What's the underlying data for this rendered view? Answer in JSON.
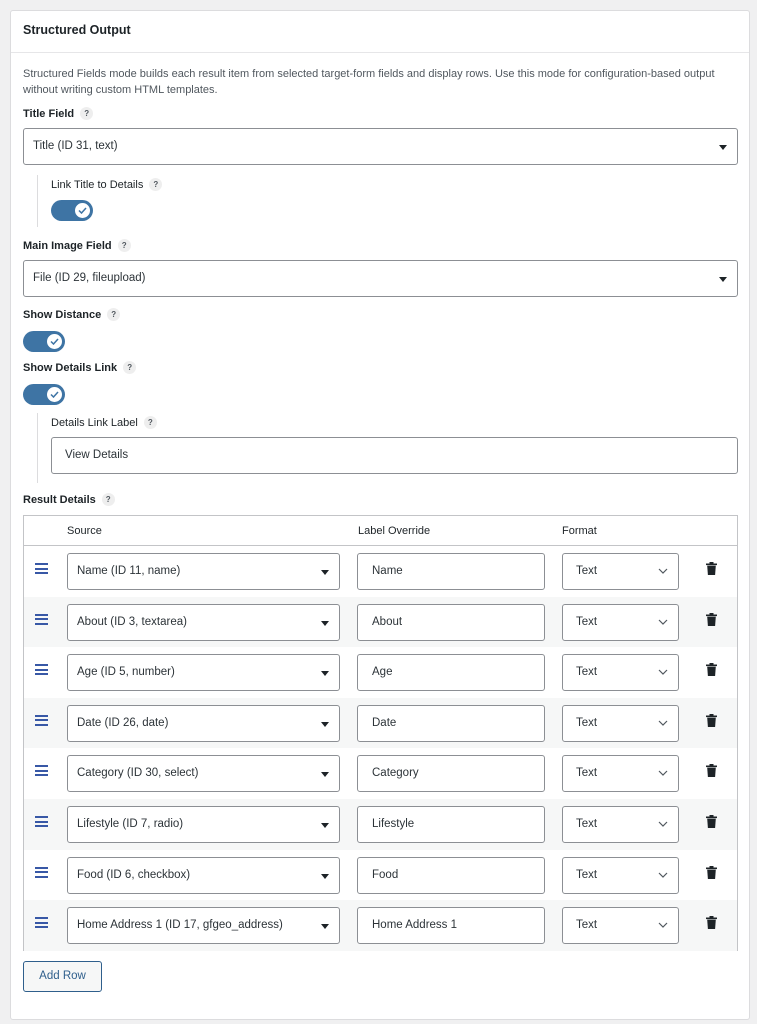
{
  "panel": {
    "title": "Structured Output",
    "description": "Structured Fields mode builds each result item from selected target-form fields and display rows. Use this mode for configuration-based output without writing custom HTML templates."
  },
  "title_field": {
    "label": "Title Field",
    "help": "?",
    "value": "Title (ID 31, text)"
  },
  "link_title": {
    "label": "Link Title to Details",
    "help": "?",
    "enabled": true
  },
  "main_image": {
    "label": "Main Image Field",
    "help": "?",
    "value": "File (ID 29, fileupload)"
  },
  "show_distance": {
    "label": "Show Distance",
    "help": "?",
    "enabled": true
  },
  "show_details_link": {
    "label": "Show Details Link",
    "help": "?",
    "enabled": true
  },
  "details_link_label": {
    "label": "Details Link Label",
    "help": "?",
    "value": "View Details"
  },
  "result_details": {
    "label": "Result Details",
    "help": "?",
    "columns": {
      "source": "Source",
      "label_override": "Label Override",
      "format": "Format"
    },
    "rows": [
      {
        "source": "Name (ID 11, name)",
        "label": "Name",
        "format": "Text"
      },
      {
        "source": "About (ID 3, textarea)",
        "label": "About",
        "format": "Text"
      },
      {
        "source": "Age (ID 5, number)",
        "label": "Age",
        "format": "Text"
      },
      {
        "source": "Date (ID 26, date)",
        "label": "Date",
        "format": "Text"
      },
      {
        "source": "Category (ID 30, select)",
        "label": "Category",
        "format": "Text"
      },
      {
        "source": "Lifestyle (ID 7, radio)",
        "label": "Lifestyle",
        "format": "Text"
      },
      {
        "source": "Food (ID 6, checkbox)",
        "label": "Food",
        "format": "Text"
      },
      {
        "source": "Home Address 1 (ID 17, gfgeo_address)",
        "label": "Home Address 1",
        "format": "Text"
      }
    ]
  },
  "add_row_button": "Add Row",
  "colors": {
    "accent": "#3e74a4",
    "button_text": "#2f5f8c",
    "drag_handle": "#3858a6"
  }
}
